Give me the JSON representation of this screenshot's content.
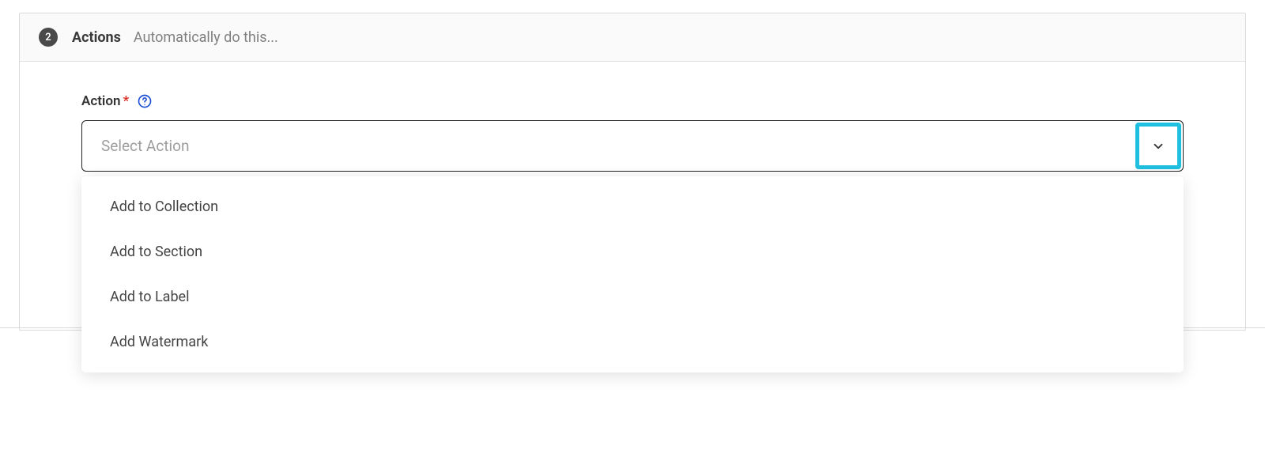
{
  "step": {
    "number": "2",
    "title": "Actions",
    "subtitle": "Automatically do this..."
  },
  "field": {
    "label": "Action",
    "required_mark": "*",
    "placeholder": "Select Action"
  },
  "dropdown": {
    "options": [
      {
        "label": "Add to Collection"
      },
      {
        "label": "Add to Section"
      },
      {
        "label": "Add to Label"
      },
      {
        "label": "Add Watermark"
      }
    ]
  },
  "icons": {
    "help": "help-circle-icon",
    "chevron": "chevron-down-icon"
  }
}
